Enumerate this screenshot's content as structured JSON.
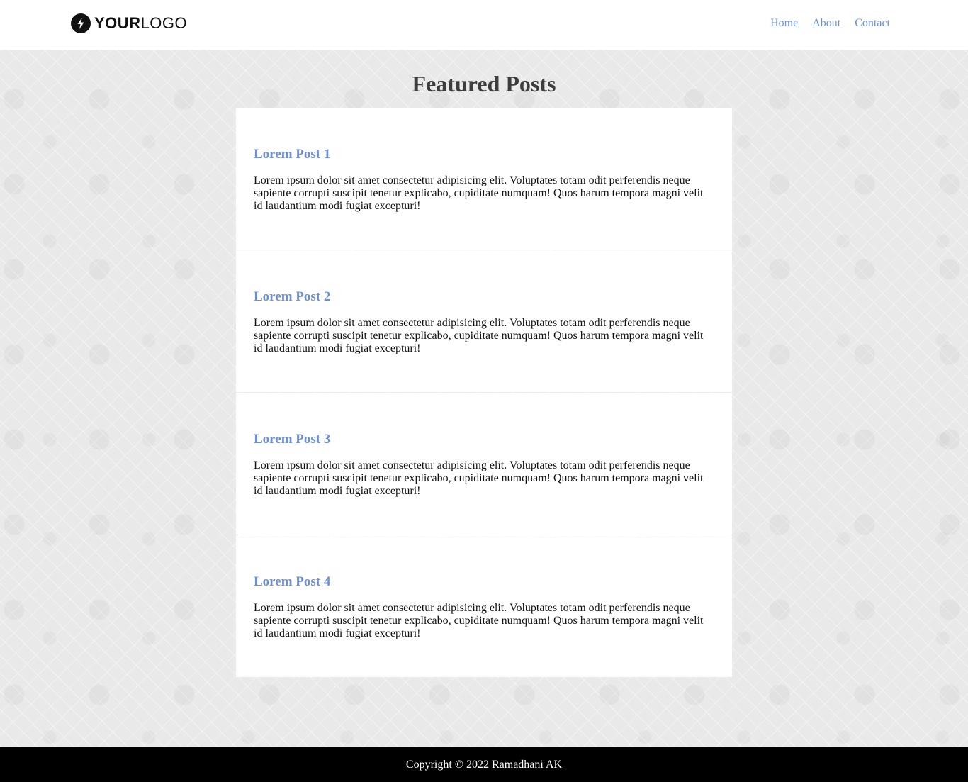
{
  "header": {
    "logo": {
      "icon": "bolt-icon",
      "text_bold": "YOUR",
      "text_regular": "LOGO"
    },
    "nav": {
      "items": [
        {
          "label": "Home"
        },
        {
          "label": "About"
        },
        {
          "label": "Contact"
        }
      ]
    }
  },
  "main": {
    "title": "Featured Posts",
    "posts": [
      {
        "title": "Lorem Post 1",
        "body": "Lorem ipsum dolor sit amet consectetur adipisicing elit. Voluptates totam odit perferendis neque sapiente corrupti suscipit tenetur explicabo, cupiditate numquam! Quos harum tempora magni velit id laudantium modi fugiat excepturi!"
      },
      {
        "title": "Lorem Post 2",
        "body": "Lorem ipsum dolor sit amet consectetur adipisicing elit. Voluptates totam odit perferendis neque sapiente corrupti suscipit tenetur explicabo, cupiditate numquam! Quos harum tempora magni velit id laudantium modi fugiat excepturi!"
      },
      {
        "title": "Lorem Post 3",
        "body": "Lorem ipsum dolor sit amet consectetur adipisicing elit. Voluptates totam odit perferendis neque sapiente corrupti suscipit tenetur explicabo, cupiditate numquam! Quos harum tempora magni velit id laudantium modi fugiat excepturi!"
      },
      {
        "title": "Lorem Post 4",
        "body": "Lorem ipsum dolor sit amet consectetur adipisicing elit. Voluptates totam odit perferendis neque sapiente corrupti suscipit tenetur explicabo, cupiditate numquam! Quos harum tempora magni velit id laudantium modi fugiat excepturi!"
      }
    ]
  },
  "footer": {
    "copyright": "Copyright © 2022 Ramadhani AK"
  },
  "colors": {
    "link": "#6b8fd8",
    "page_background": "#e9e9e9",
    "card_background": "#ffffff",
    "heading": "#3d3d3d",
    "footer_background": "#000000",
    "footer_text": "#ffffff"
  }
}
